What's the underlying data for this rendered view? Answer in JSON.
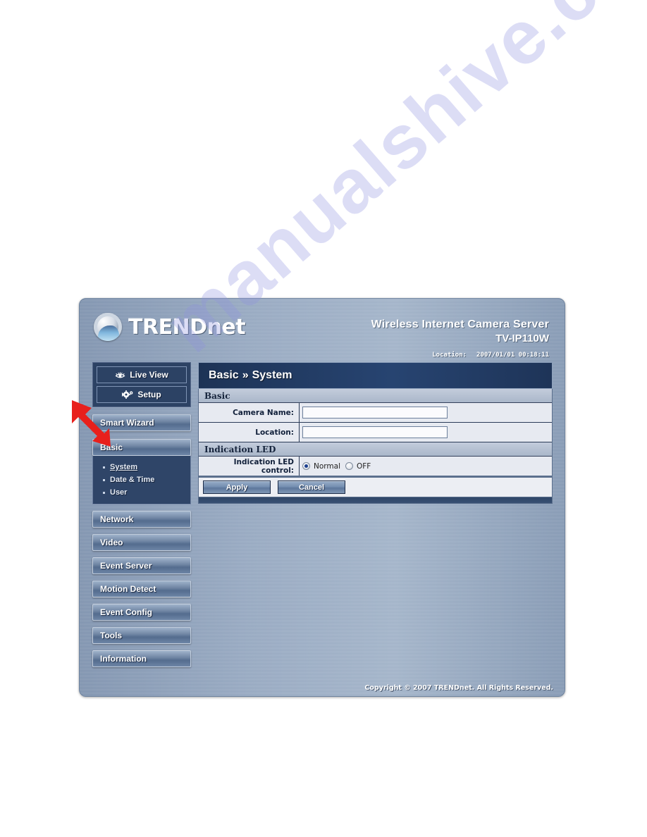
{
  "page": {
    "watermark": "manualshive.com"
  },
  "header": {
    "logo_text_main": "TREND",
    "logo_text_suffix": "net",
    "logo_icon": "trendnet-globe-icon",
    "product_name": "Wireless Internet Camera Server",
    "product_model": "TV-IP110W",
    "location_label": "Location:",
    "location_value": "2007/01/01 00:18:11"
  },
  "sidebar": {
    "modes": [
      {
        "label": "Live View",
        "icon": "eye-icon"
      },
      {
        "label": "Setup",
        "icon": "gear-icon"
      }
    ],
    "wizard_label": "Smart Wizard",
    "sections": [
      {
        "label": "Basic",
        "items": [
          {
            "label": "System",
            "active": true
          },
          {
            "label": "Date & Time",
            "active": false
          },
          {
            "label": "User",
            "active": false
          }
        ]
      }
    ],
    "nav": [
      {
        "label": "Network"
      },
      {
        "label": "Video"
      },
      {
        "label": "Event Server"
      },
      {
        "label": "Motion Detect"
      },
      {
        "label": "Event Config"
      },
      {
        "label": "Tools"
      },
      {
        "label": "Information"
      }
    ]
  },
  "content": {
    "title_primary": "Basic",
    "title_separator": "»",
    "title_secondary": "System",
    "sections": [
      {
        "heading": "Basic",
        "rows": [
          {
            "label": "Camera Name:",
            "type": "text",
            "value": ""
          },
          {
            "label": "Location:",
            "type": "text",
            "value": ""
          }
        ]
      },
      {
        "heading": "Indication LED",
        "rows": [
          {
            "label": "Indication LED control:",
            "type": "radio",
            "options": [
              {
                "label": "Normal",
                "selected": true
              },
              {
                "label": "OFF",
                "selected": false
              }
            ]
          }
        ]
      }
    ],
    "actions": [
      {
        "label": "Apply"
      },
      {
        "label": "Cancel"
      }
    ]
  },
  "footer": {
    "copyright": "Copyright © 2007 TRENDnet. All Rights Reserved."
  },
  "annotation": {
    "arrow_color": "#e8201c",
    "arrow_target": "smart-wizard-button"
  }
}
